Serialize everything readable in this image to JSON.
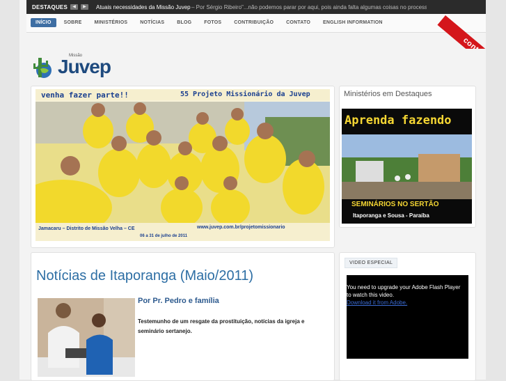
{
  "ticker": {
    "label": "DESTAQUES",
    "prev_glyph": "◀",
    "next_glyph": "▶",
    "headline": "Atuais necessidades da Missão Juvep",
    "excerpt": "– Por Sérgio Ribeiro\"...não podemos parar por aqui, pois ainda falta algumas coisas no processo de"
  },
  "nav": {
    "items": [
      "INÍCIO",
      "SOBRE",
      "MINISTÉRIOS",
      "NOTÍCIAS",
      "BLOG",
      "FOTOS",
      "CONTRIBUIÇÃO",
      "CONTATO",
      "ENGLISH INFORMATION"
    ],
    "active_index": 0
  },
  "ribbon": {
    "label": "contribua"
  },
  "logo": {
    "small": "Missão",
    "word": "Juvep"
  },
  "feature": {
    "headline_left": "venha fazer parte!!",
    "headline_right": "55 Projeto Missionário da Juvep",
    "footer_left": "Jamacaru – Distrito de Missão Velha – CE",
    "footer_right": "www.juvep.com.br/projetomissionario",
    "footer_dates": "06 a 31 de julho de 2011"
  },
  "sidebar": {
    "title": "Ministérios em Destaques",
    "promo_top": "Aprenda fazendo",
    "promo_bottom": "SEMINÁRIOS NO SERTÃO",
    "promo_sub": "Itaporanga e Sousa - Paraíba"
  },
  "post": {
    "title": "Notícias de Itaporanga (Maio/2011)",
    "author": "Por Pr. Pedro e família",
    "excerpt": "Testemunho de um resgate da prostituição, notícias da igreja e seminário sertanejo."
  },
  "video": {
    "tab_label": "VIDEO ESPECIAL",
    "message": "You need to upgrade your Adobe Flash Player to watch this video.",
    "link": "Download it from Adobe."
  },
  "colors": {
    "accent": "#3e6ea3",
    "title_blue": "#2d6ea4",
    "ribbon_red": "#d4161b",
    "topbar": "#2b2b2b"
  }
}
